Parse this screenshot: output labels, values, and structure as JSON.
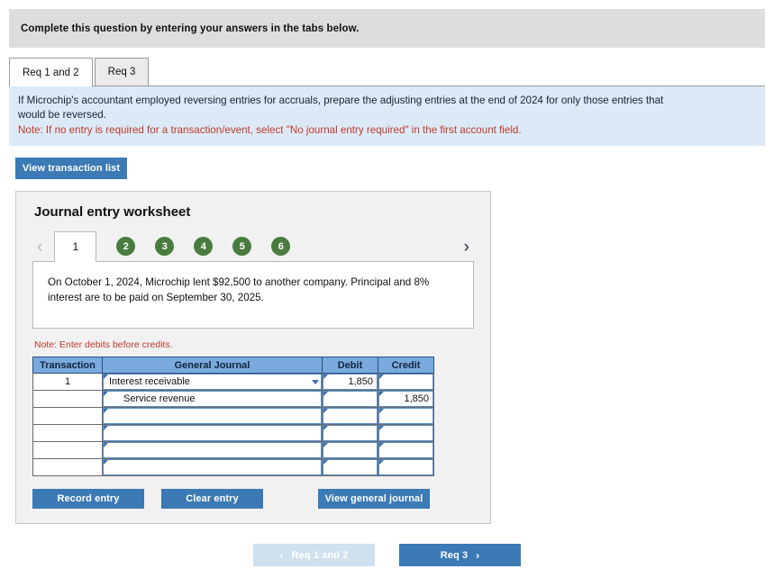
{
  "banner": {
    "text": "Complete this question by entering your answers in the tabs below."
  },
  "tabs": [
    {
      "label": "Req 1 and 2",
      "active": true
    },
    {
      "label": "Req 3",
      "active": false
    }
  ],
  "instruction": {
    "main": "If Microchip's accountant employed reversing entries for accruals, prepare the adjusting entries at the end of 2024 for only those entries that would be reversed.",
    "note": "Note: If no entry is required for a transaction/event, select \"No journal entry required\" in the first account field."
  },
  "view_transaction_list_label": "View transaction list",
  "worksheet": {
    "title": "Journal entry worksheet",
    "pager": {
      "prev_icon": "chevron-left-icon",
      "next_icon": "chevron-right-icon",
      "active_page": "1",
      "pages": [
        "2",
        "3",
        "4",
        "5",
        "6"
      ]
    },
    "transaction_description": "On October 1, 2024, Microchip lent $92,500 to another company. Principal and 8% interest are to be paid on September 30, 2025.",
    "debits_note": "Note: Enter debits before credits.",
    "table": {
      "headers": [
        "Transaction",
        "General Journal",
        "Debit",
        "Credit"
      ],
      "rows": [
        {
          "transaction": "1",
          "account": "Interest receivable",
          "indent": false,
          "dropdown": true,
          "debit": "1,850",
          "credit": ""
        },
        {
          "transaction": "",
          "account": "Service revenue",
          "indent": true,
          "dropdown": false,
          "debit": "",
          "credit": "1,850"
        },
        {
          "transaction": "",
          "account": "",
          "indent": false,
          "dropdown": false,
          "debit": "",
          "credit": ""
        },
        {
          "transaction": "",
          "account": "",
          "indent": false,
          "dropdown": false,
          "debit": "",
          "credit": ""
        },
        {
          "transaction": "",
          "account": "",
          "indent": false,
          "dropdown": false,
          "debit": "",
          "credit": ""
        },
        {
          "transaction": "",
          "account": "",
          "indent": false,
          "dropdown": false,
          "debit": "",
          "credit": ""
        }
      ]
    },
    "actions": {
      "record": "Record entry",
      "clear": "Clear entry",
      "view_general_journal": "View general journal"
    }
  },
  "bottom_nav": {
    "prev_label": "Req 1 and 2",
    "prev_icon": "chevron-left-icon",
    "next_label": "Req 3",
    "next_icon": "chevron-right-icon"
  },
  "colors": {
    "accent_blue": "#3b7ab5",
    "table_header_blue": "#7aaade",
    "pager_green": "#4a7c3f",
    "note_red": "#c0392b",
    "instruction_bg": "#dceaf7",
    "banner_bg": "#dddddd",
    "panel_bg": "#f1f1f1",
    "disabled_blue": "#cfe0ef"
  }
}
